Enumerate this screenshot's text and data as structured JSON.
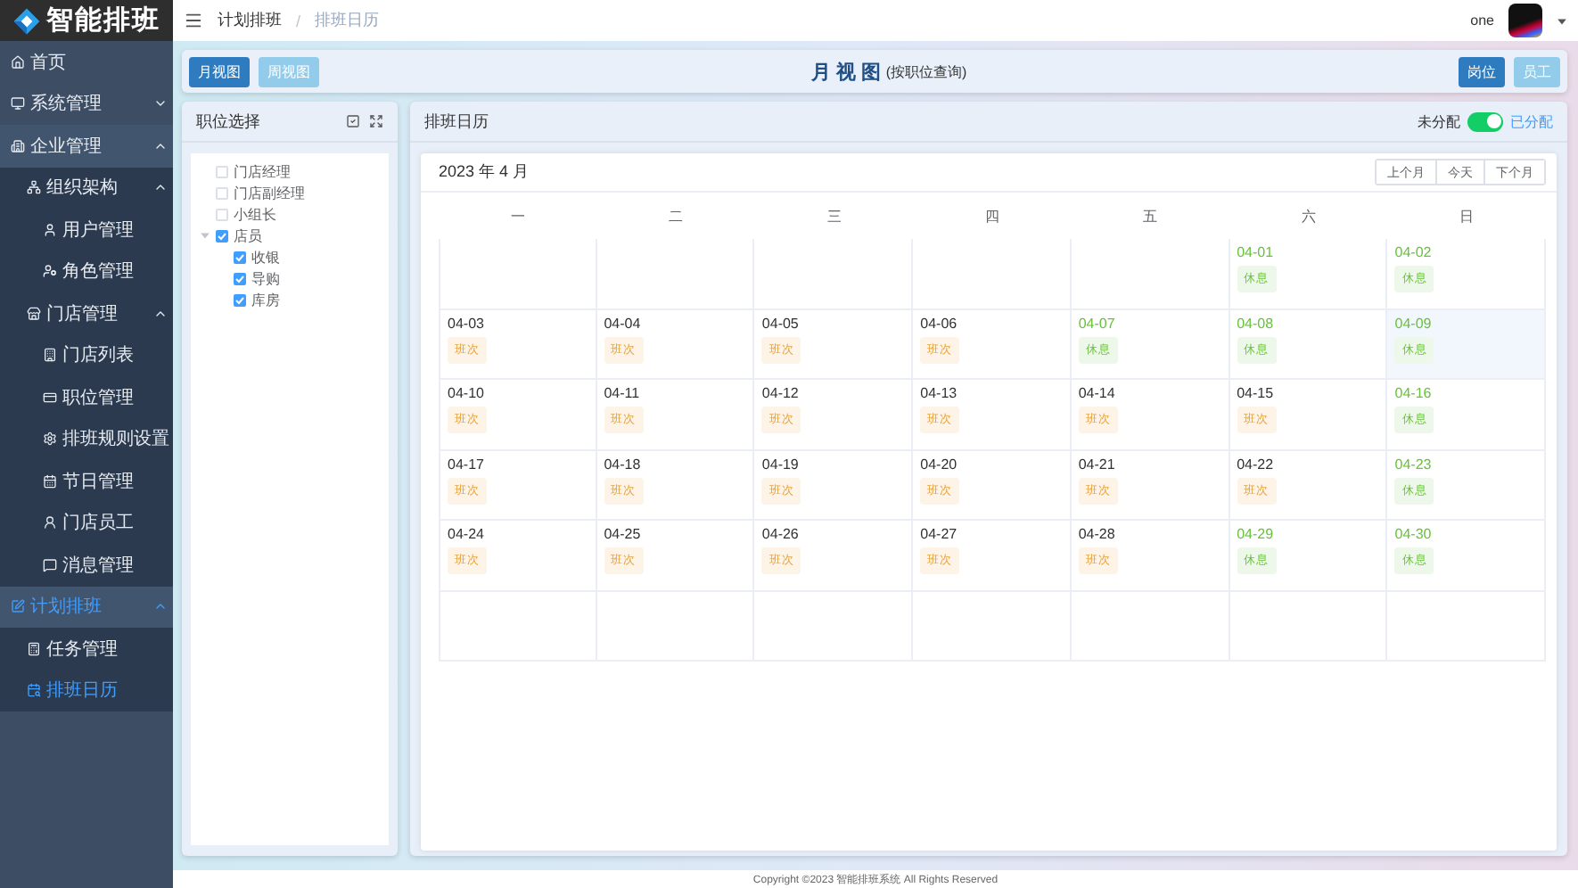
{
  "logo": {
    "title": "智能排班"
  },
  "sidebar": {
    "items": [
      {
        "label": "首页",
        "selected": false
      },
      {
        "label": "系统管理",
        "selected": false,
        "expanded": false
      },
      {
        "label": "企业管理",
        "selected": false,
        "expanded": true,
        "children": [
          {
            "label": "组织架构",
            "selected": false,
            "expanded": true,
            "children": [
              {
                "label": "用户管理",
                "selected": false
              },
              {
                "label": "角色管理",
                "selected": false
              }
            ]
          },
          {
            "label": "门店管理",
            "selected": false,
            "expanded": true,
            "children": [
              {
                "label": "门店列表",
                "selected": false
              },
              {
                "label": "职位管理",
                "selected": false
              },
              {
                "label": "排班规则设置",
                "selected": false
              },
              {
                "label": "节日管理",
                "selected": false
              },
              {
                "label": "门店员工",
                "selected": false
              },
              {
                "label": "消息管理",
                "selected": false
              }
            ]
          }
        ]
      },
      {
        "label": "计划排班",
        "selected": true,
        "expanded": true,
        "children": [
          {
            "label": "任务管理",
            "selected": false
          },
          {
            "label": "排班日历",
            "selected": true
          }
        ]
      }
    ]
  },
  "header": {
    "breadcrumb": [
      "计划排班",
      "排班日历"
    ],
    "separator": "/",
    "user": "one"
  },
  "toolbar": {
    "view_buttons": [
      {
        "label": "月视图",
        "selected": true
      },
      {
        "label": "周视图",
        "selected": false
      }
    ],
    "title": "月 视 图",
    "subtitle": "(按职位查询)",
    "mode_buttons": [
      {
        "label": "岗位",
        "selected": true
      },
      {
        "label": "员工",
        "selected": false
      }
    ]
  },
  "position_panel": {
    "title": "职位选择",
    "tree": [
      {
        "label": "门店经理",
        "checked": false
      },
      {
        "label": "门店副经理",
        "checked": false
      },
      {
        "label": "小组长",
        "checked": false
      },
      {
        "label": "店员",
        "checked": true,
        "expanded": true,
        "children": [
          {
            "label": "收银",
            "checked": true
          },
          {
            "label": "导购",
            "checked": true
          },
          {
            "label": "库房",
            "checked": true
          }
        ]
      }
    ]
  },
  "calendar_panel": {
    "title": "排班日历",
    "toggle": {
      "off_label": "未分配",
      "on_label": "已分配",
      "on": true
    },
    "month": "2023 年 4 月",
    "nav_buttons": [
      "上个月",
      "今天",
      "下个月"
    ],
    "weekdays": [
      "一",
      "二",
      "三",
      "四",
      "五",
      "六",
      "日"
    ],
    "weeks": [
      [
        {
          "kind": "blank"
        },
        {
          "kind": "blank"
        },
        {
          "kind": "blank"
        },
        {
          "kind": "blank"
        },
        {
          "kind": "blank"
        },
        {
          "date": "04-01",
          "tag": "休息",
          "kind": "rest",
          "selected": false
        },
        {
          "date": "04-02",
          "tag": "休息",
          "kind": "rest",
          "selected": false
        }
      ],
      [
        {
          "date": "04-03",
          "tag": "班次",
          "kind": "work",
          "selected": false
        },
        {
          "date": "04-04",
          "tag": "班次",
          "kind": "work",
          "selected": false
        },
        {
          "date": "04-05",
          "tag": "班次",
          "kind": "work",
          "selected": false
        },
        {
          "date": "04-06",
          "tag": "班次",
          "kind": "work",
          "selected": false
        },
        {
          "date": "04-07",
          "tag": "休息",
          "kind": "rest",
          "selected": false
        },
        {
          "date": "04-08",
          "tag": "休息",
          "kind": "rest",
          "selected": false
        },
        {
          "date": "04-09",
          "tag": "休息",
          "kind": "rest",
          "selected": true
        }
      ],
      [
        {
          "date": "04-10",
          "tag": "班次",
          "kind": "work",
          "selected": false
        },
        {
          "date": "04-11",
          "tag": "班次",
          "kind": "work",
          "selected": false
        },
        {
          "date": "04-12",
          "tag": "班次",
          "kind": "work",
          "selected": false
        },
        {
          "date": "04-13",
          "tag": "班次",
          "kind": "work",
          "selected": false
        },
        {
          "date": "04-14",
          "tag": "班次",
          "kind": "work",
          "selected": false
        },
        {
          "date": "04-15",
          "tag": "班次",
          "kind": "work",
          "selected": false
        },
        {
          "date": "04-16",
          "tag": "休息",
          "kind": "rest",
          "selected": false
        }
      ],
      [
        {
          "date": "04-17",
          "tag": "班次",
          "kind": "work",
          "selected": false
        },
        {
          "date": "04-18",
          "tag": "班次",
          "kind": "work",
          "selected": false
        },
        {
          "date": "04-19",
          "tag": "班次",
          "kind": "work",
          "selected": false
        },
        {
          "date": "04-20",
          "tag": "班次",
          "kind": "work",
          "selected": false
        },
        {
          "date": "04-21",
          "tag": "班次",
          "kind": "work",
          "selected": false
        },
        {
          "date": "04-22",
          "tag": "班次",
          "kind": "work",
          "selected": false
        },
        {
          "date": "04-23",
          "tag": "休息",
          "kind": "rest",
          "selected": false
        }
      ],
      [
        {
          "date": "04-24",
          "tag": "班次",
          "kind": "work",
          "selected": false
        },
        {
          "date": "04-25",
          "tag": "班次",
          "kind": "work",
          "selected": false
        },
        {
          "date": "04-26",
          "tag": "班次",
          "kind": "work",
          "selected": false
        },
        {
          "date": "04-27",
          "tag": "班次",
          "kind": "work",
          "selected": false
        },
        {
          "date": "04-28",
          "tag": "班次",
          "kind": "work",
          "selected": false
        },
        {
          "date": "04-29",
          "tag": "休息",
          "kind": "rest",
          "selected": false
        },
        {
          "date": "04-30",
          "tag": "休息",
          "kind": "rest",
          "selected": false
        }
      ],
      [
        {
          "kind": "blank"
        },
        {
          "kind": "blank"
        },
        {
          "kind": "blank"
        },
        {
          "kind": "blank"
        },
        {
          "kind": "blank"
        },
        {
          "kind": "blank"
        },
        {
          "kind": "blank"
        }
      ]
    ]
  },
  "footer": "Copyright ©2023 智能排班系统 All Rights Reserved"
}
